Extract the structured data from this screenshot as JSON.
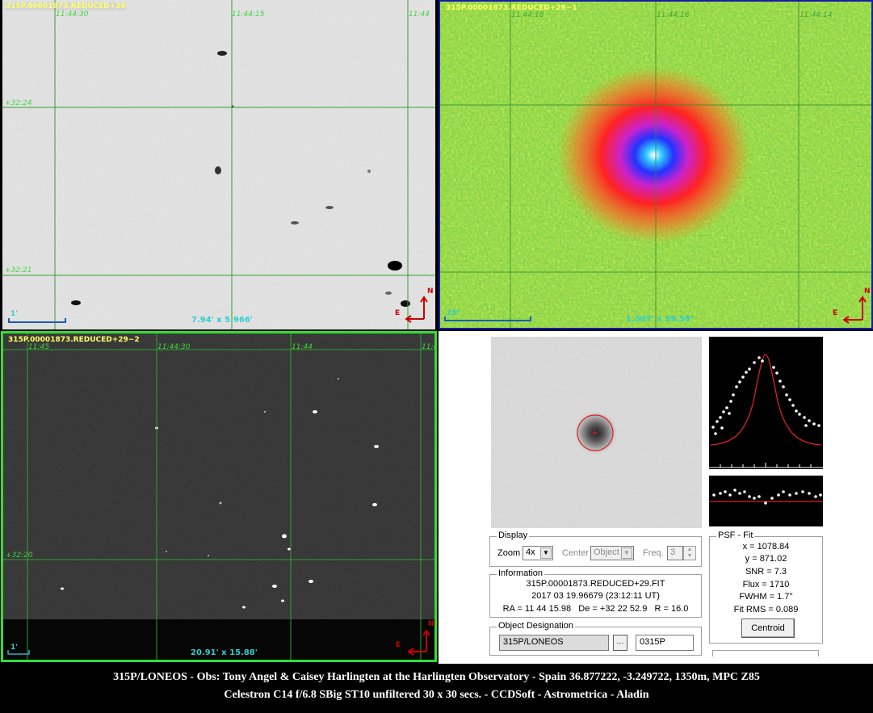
{
  "panels": {
    "top_left": {
      "title": "315P.00001873.REDUCED+29",
      "ra_labels": [
        "11:44:30",
        "11:44:15",
        "11:44"
      ],
      "dec_labels": [
        "+32:24",
        "+32:21"
      ],
      "scale_label": "1'",
      "dimensions": "7.94' x 5.966'",
      "compass": {
        "north": "N",
        "east": "E"
      }
    },
    "top_right": {
      "title": "315P.00001873.REDUCED+29~1",
      "ra_labels": [
        "11:44:18",
        "11:44:16",
        "11:44:14"
      ],
      "scale_label": "15\"",
      "dimensions": "1.307' x 59.58\"",
      "compass": {
        "north": "N",
        "east": "E"
      }
    },
    "bottom_left": {
      "title": "315P.00001873.REDUCED+29~2",
      "ra_labels": [
        "11:45",
        "11:44:30",
        "11:44",
        "11:4"
      ],
      "dec_labels": [
        "+32:20"
      ],
      "scale_label": "1'",
      "dimensions": "20.91' x 15.88'",
      "compass": {
        "north": "N",
        "east": "E"
      }
    }
  },
  "dialog": {
    "display": {
      "group_title": "Display",
      "zoom_label": "Zoom",
      "zoom_value": "4x",
      "center_label": "Center",
      "center_value": "Object",
      "freq_label": "Freq.",
      "freq_value": "3"
    },
    "information": {
      "group_title": "Information",
      "filename": "315P.00001873.REDUCED+29.FIT",
      "datetime": "2017 03 19.96679 (23:12:11 UT)",
      "coords": "RA = 11 44 15.98   De = +32 22 52.9   R = 16.0"
    },
    "object_designation": {
      "group_title": "Object Designation",
      "name_value": "315P/LONEOS",
      "code_value": "0315P"
    },
    "psf_fit": {
      "group_title": "PSF - Fit",
      "x": "x = 1078.84",
      "y": "y = 871.02",
      "snr": "SNR = 7.3",
      "flux": "Flux = 1710",
      "fwhm": "FWHM = 1.7''",
      "fit_rms": "Fit RMS = 0.089",
      "centroid_button": "Centroid"
    }
  },
  "caption": {
    "line1": "315P/LONEOS - Obs: Tony Angel & Caisey Harlingten at the Harlingten Observatory - Spain 36.877222, -3.249722, 1350m, MPC Z85",
    "line2": "Celestron C14 f/6.8 SBig ST10 unfiltered 30 x 30 secs. - CCDSoft - Astrometrica - Aladin"
  },
  "colors": {
    "grid": "#2fa32f",
    "coord_text": "#3fd63f",
    "title_text": "#ffff66",
    "scale_text": "#33cccc",
    "compass": "#cc0000",
    "frame_top_right": "#1a1aa8",
    "frame_bottom_left": "#33dd33",
    "fit_curve": "#dd2222"
  }
}
